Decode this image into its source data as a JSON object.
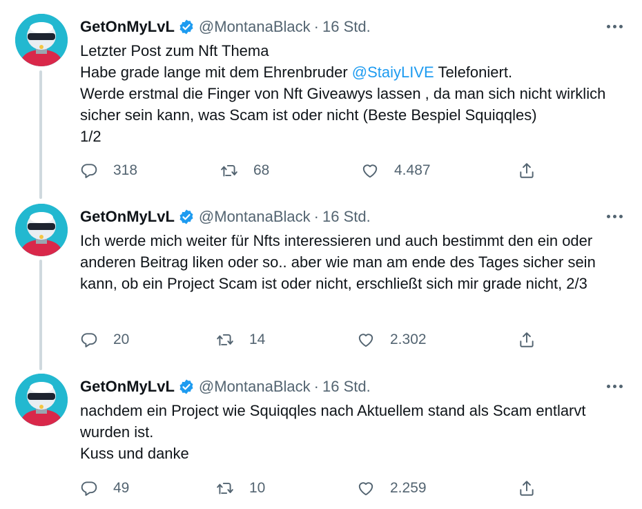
{
  "tweets": [
    {
      "name": "GetOnMyLvL",
      "handle": "@MontanaBlack",
      "separator": "·",
      "time": "16 Std.",
      "text_before": "Letzter Post zum Nft Thema\nHabe grade lange mit dem Ehrenbruder ",
      "mention": "@StaiyLIVE",
      "text_after": " Telefoniert.\nWerde erstmal die Finger von Nft Giveawys lassen , da man sich nicht wirklich sicher sein kann, was Scam ist oder nicht (Beste Bespiel Squiqqles)\n1/2",
      "replies": "318",
      "retweets": "68",
      "likes": "4.487"
    },
    {
      "name": "GetOnMyLvL",
      "handle": "@MontanaBlack",
      "separator": "·",
      "time": "16 Std.",
      "text": "Ich werde mich weiter für Nfts interessieren und auch bestimmt den ein oder anderen Beitrag liken oder so.. aber wie man am ende des Tages sicher sein kann, ob ein Project Scam ist oder nicht, erschließt sich mir grade nicht, 2/3",
      "replies": "20",
      "retweets": "14",
      "likes": "2.302"
    },
    {
      "name": "GetOnMyLvL",
      "handle": "@MontanaBlack",
      "separator": "·",
      "time": "16 Std.",
      "text": "nachdem ein Project wie Squiqqles nach Aktuellem stand als Scam entlarvt wurden ist.\nKuss und danke",
      "replies": "49",
      "retweets": "10",
      "likes": "2.259"
    }
  ],
  "icons": {
    "verified": "verified-badge-icon",
    "more": "more-dots-icon",
    "reply": "reply-bubble-icon",
    "retweet": "retweet-icon",
    "like": "heart-icon",
    "share": "share-icon"
  },
  "colors": {
    "text": "#0f1419",
    "muted": "#536471",
    "link": "#1d9bf0",
    "verified": "#1d9bf0",
    "thread_line": "#cfd9de"
  }
}
